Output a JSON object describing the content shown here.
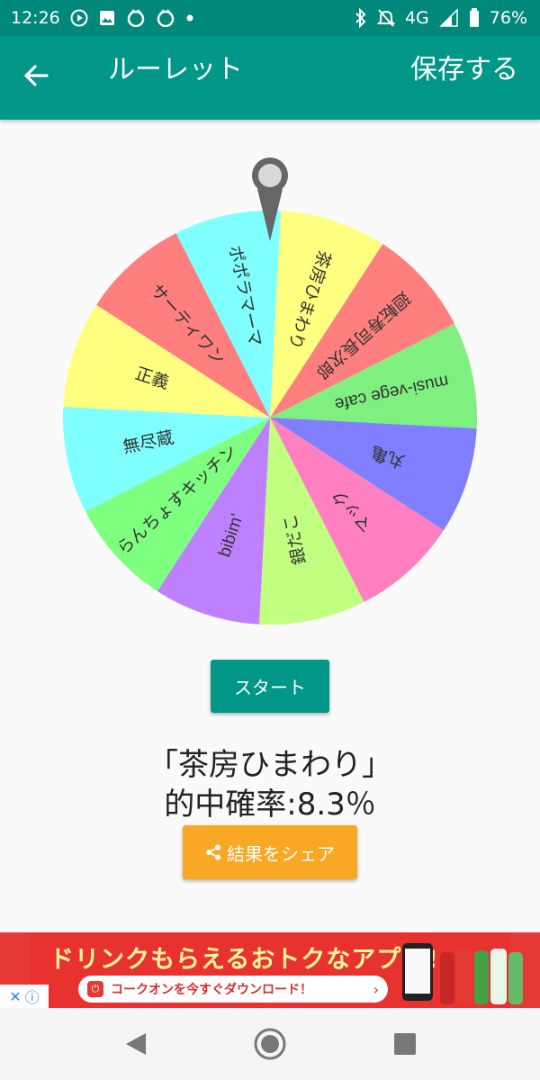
{
  "status_bar": {
    "time": "12:26",
    "network": "4G",
    "battery": "76%",
    "left_icons": [
      "play-icon",
      "image-icon",
      "app-icon",
      "app-icon",
      "dot-icon"
    ],
    "right_icons": [
      "bluetooth-icon",
      "mute-icon",
      "signal-icon",
      "battery-icon"
    ]
  },
  "app_bar": {
    "title": "ルーレット",
    "save_label": "保存する",
    "back_icon": "arrow-left-icon",
    "color": "#009688"
  },
  "wheel": {
    "segments": [
      {
        "label": "茶房ひまわり",
        "color": "#ffff80"
      },
      {
        "label": "廻転寿司長次郎",
        "color": "#ff7f7f"
      },
      {
        "label": "musi-vege cafe",
        "color": "#7fef7f"
      },
      {
        "label": "丸亀",
        "color": "#7f7fff"
      },
      {
        "label": "マック",
        "color": "#ff80c0"
      },
      {
        "label": "銀だこ",
        "color": "#c0ff7f"
      },
      {
        "label": "bibim'",
        "color": "#bf80ff"
      },
      {
        "label": "らんちょすキッチン",
        "color": "#7fff7f"
      },
      {
        "label": "無尽蔵",
        "color": "#7fffff"
      },
      {
        "label": "正義",
        "color": "#ffff7f"
      },
      {
        "label": "サーティワン",
        "color": "#ff7f7f"
      },
      {
        "label": "ポポラマーマ",
        "color": "#7fffff"
      }
    ]
  },
  "start_label": "スタート",
  "result": {
    "name": "「茶房ひまわり」",
    "probability": "的中確率:8.3％"
  },
  "share_label": "結果をシェア",
  "ad": {
    "headline": "ドリンクもらえるおトクなアプリ!",
    "cta": "コークオンを今すぐダウンロード！"
  }
}
